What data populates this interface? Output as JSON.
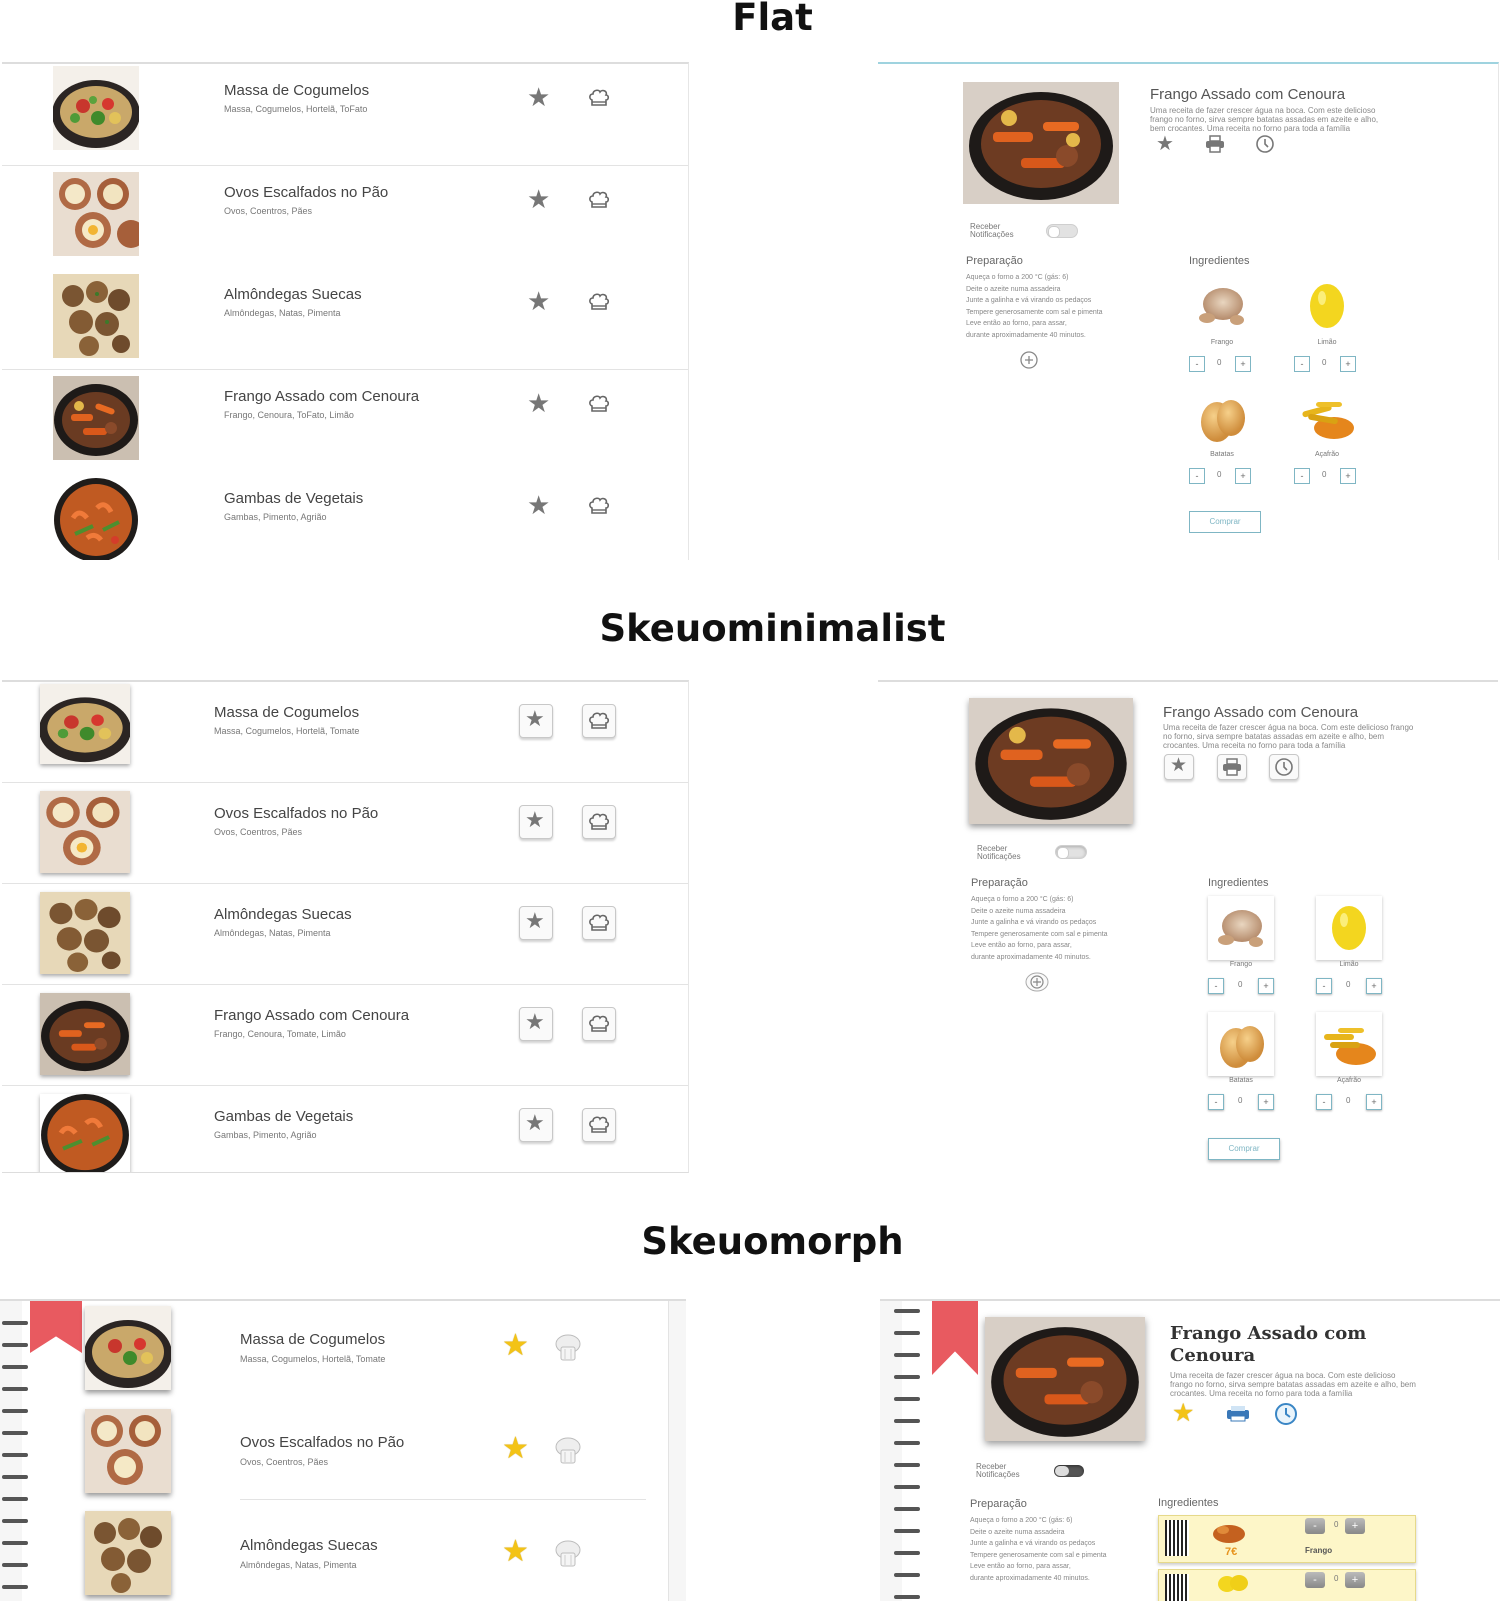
{
  "sections": {
    "flat": "Flat",
    "skeuominimalist": "Skeuominimalist",
    "skeuomorph": "Skeuomorph"
  },
  "flat": {
    "list": [
      {
        "title": "Massa de Cogumelos",
        "subtitle": "Massa, Cogumelos, Hortelã, ToFato"
      },
      {
        "title": "Ovos Escalfados no Pão",
        "subtitle": "Ovos, Coentros, Pães"
      },
      {
        "title": "Almôndegas Suecas",
        "subtitle": "Almôndegas, Natas, Pimenta"
      },
      {
        "title": "Frango Assado com Cenoura",
        "subtitle": "Frango, Cenoura, ToFato, Limão"
      },
      {
        "title": "Gambas de Vegetais",
        "subtitle": "Gambas, Pimento, Agrião"
      }
    ],
    "detail": {
      "title": "Frango Assado com Cenoura",
      "description": "Uma receita de fazer crescer água na boca. Com este delicioso frango no forno, sirva sempre batatas assadas em azeite e alho, bem crocantes. Uma receita no forno para toda a família",
      "notifications_label": "Receber Notificações",
      "preparation_heading": "Preparação",
      "preparation_steps": [
        "Aqueça o forno a 200 °C (gás: 6)",
        "Deite o azeite numa assadeira",
        "Junte a galinha e vá virando os pedaços",
        "Tempere generosamente com sal e pimenta",
        "Leve então ao forno, para assar,",
        "durante aproximadamente 40 minutos."
      ],
      "ingredients_heading": "Ingredientes",
      "ingredients": [
        {
          "name": "Frango",
          "qty": "0"
        },
        {
          "name": "Limão",
          "qty": "0"
        },
        {
          "name": "Batatas",
          "qty": "0"
        },
        {
          "name": "Açafrão",
          "qty": "0"
        }
      ],
      "buy_label": "Comprar",
      "minus": "-",
      "plus": "+"
    }
  },
  "skeuominimalist": {
    "list": [
      {
        "title": "Massa de Cogumelos",
        "subtitle": "Massa, Cogumelos, Hortelã, Tomate"
      },
      {
        "title": "Ovos Escalfados no Pão",
        "subtitle": "Ovos, Coentros, Pães"
      },
      {
        "title": "Almôndegas Suecas",
        "subtitle": "Almôndegas, Natas, Pimenta"
      },
      {
        "title": "Frango Assado com Cenoura",
        "subtitle": "Frango, Cenoura, Tomate, Limão"
      },
      {
        "title": "Gambas de Vegetais",
        "subtitle": "Gambas, Pimento, Agrião"
      }
    ],
    "detail": {
      "title": "Frango Assado com Cenoura",
      "description": "Uma receita de fazer crescer água na boca. Com este delicioso frango no forno, sirva sempre batatas assadas em azeite e alho, bem crocantes. Uma receita no forno para toda a família",
      "notifications_label": "Receber Notificações",
      "preparation_heading": "Preparação",
      "preparation_steps": [
        "Aqueça o forno a 200 °C (gás: 6)",
        "Deite o azeite numa assadeira",
        "Junte a galinha e vá virando os pedaços",
        "Tempere generosamente com sal e pimenta",
        "Leve então ao forno, para assar,",
        "durante aproximadamente 40 minutos."
      ],
      "ingredients_heading": "Ingredientes",
      "ingredients": [
        {
          "name": "Frango",
          "qty": "0"
        },
        {
          "name": "Limão",
          "qty": "0"
        },
        {
          "name": "Batatas",
          "qty": "0"
        },
        {
          "name": "Açafrão",
          "qty": "0"
        }
      ],
      "buy_label": "Comprar",
      "minus": "-",
      "plus": "+"
    }
  },
  "skeuomorph": {
    "list": [
      {
        "title": "Massa de Cogumelos",
        "subtitle": "Massa, Cogumelos, Hortelã, Tomate"
      },
      {
        "title": "Ovos Escalfados no Pão",
        "subtitle": "Ovos, Coentros, Pães"
      },
      {
        "title": "Almôndegas Suecas",
        "subtitle": "Almôndegas, Natas, Pimenta"
      }
    ],
    "detail": {
      "title_line1": "Frango Assado com",
      "title_line2": "Cenoura",
      "description": "Uma receita de fazer crescer água na boca. Com este delicioso frango no forno, sirva sempre batatas assadas em azeite e alho, bem crocantes. Uma receita no forno para toda a família",
      "notifications_label": "Receber Notificações",
      "preparation_heading": "Preparação",
      "preparation_steps": [
        "Aqueça o forno a 200 °C (gás: 6)",
        "Deite o azeite numa assadeira",
        "Junte a galinha e vá virando os pedaços",
        "Tempere generosamente com sal e pimenta",
        "Leve então ao forno, para assar,",
        "durante aproximadamente 40 minutos."
      ],
      "ingredients_heading": "Ingredientes",
      "ingredient_price": "7€",
      "ingredient_name": "Frango",
      "qty": "0",
      "minus": "-",
      "plus": "+"
    }
  },
  "colors": {
    "accent": "#7fb6c4",
    "ribbon": "#e85a60",
    "gold": "#f3c316",
    "note": "#fdf6c8"
  }
}
